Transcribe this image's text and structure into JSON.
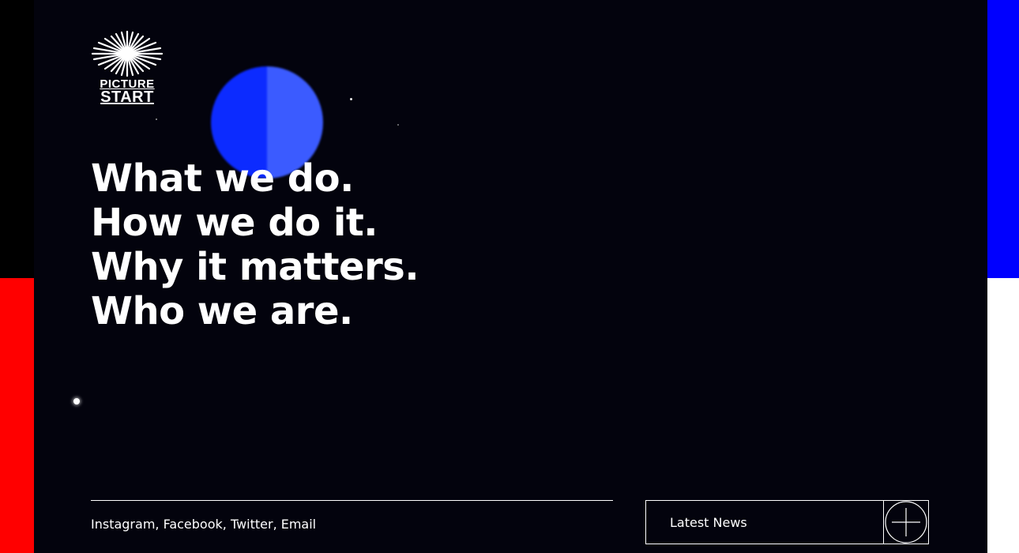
{
  "brand": {
    "logo_line1": "PICTURE",
    "logo_line2": "START",
    "logo_icon": "starburst-icon"
  },
  "hero": {
    "lines": [
      "What we do.",
      "How we do it.",
      "Why it matters.",
      "Who we are."
    ]
  },
  "footer": {
    "social_links": [
      "Instagram",
      "Facebook",
      "Twitter",
      "Email"
    ],
    "news_label": "Latest News",
    "news_icon": "plus-circle-icon"
  },
  "colors": {
    "background": "#03030d",
    "orb": "#0c2bff",
    "left_band_bottom": "#ff0000",
    "right_band_top": "#0000ff",
    "right_band_bottom": "#ffffff",
    "text": "#ffffff"
  }
}
